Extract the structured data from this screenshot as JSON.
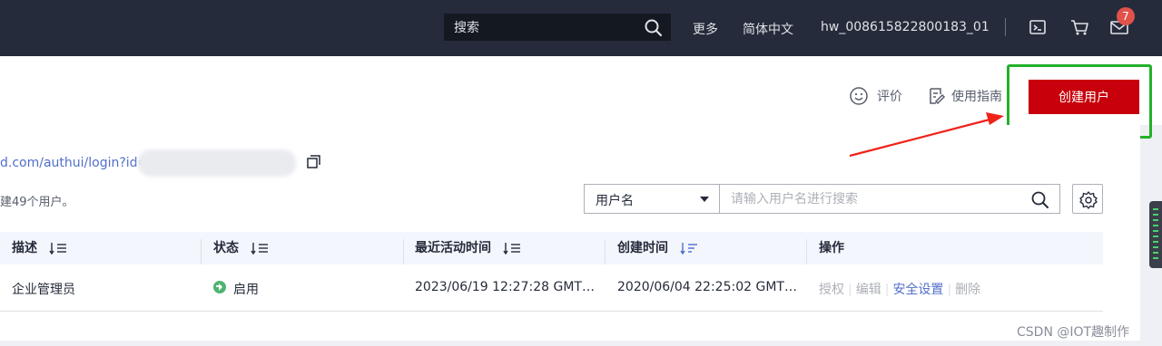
{
  "topbar": {
    "search_placeholder": "搜索",
    "more": "更多",
    "language": "简体中文",
    "username": "hw_008615822800183_01",
    "notification_count": "7",
    "icons": [
      "search-icon",
      "terminal-icon",
      "cart-icon",
      "mail-icon"
    ]
  },
  "header": {
    "feedback_label": "评价",
    "guide_label": "使用指南",
    "create_user_label": "创建用户"
  },
  "info": {
    "login_url": "d.com/authui/login?id=",
    "user_count_text": "建49个用户。"
  },
  "filter": {
    "select_value": "用户名",
    "search_placeholder": "请输入用户名进行搜索"
  },
  "table": {
    "columns": [
      "描述",
      "状态",
      "最近活动时间",
      "创建时间",
      "操作"
    ],
    "rows": [
      {
        "description": "企业管理员",
        "status": "启用",
        "last_active": "2023/06/19 12:27:28 GMT…",
        "created": "2020/06/04 22:25:02 GMT…",
        "actions": [
          "授权",
          "编辑",
          "安全设置",
          "删除"
        ]
      }
    ]
  },
  "colors": {
    "topbar": "#252b3a",
    "primary_button": "#c7000b",
    "highlight_box": "#22b02a",
    "link": "#526ecc",
    "status_ok": "#50b371"
  },
  "watermark": "CSDN @IOT趣制作"
}
